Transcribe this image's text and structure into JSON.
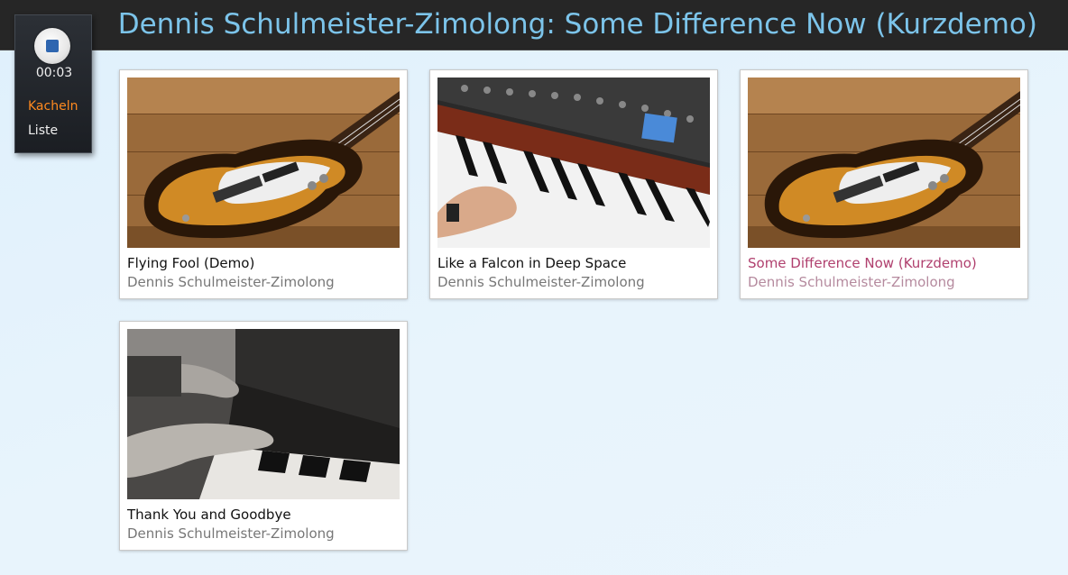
{
  "header": {
    "title": "Dennis Schulmeister-Zimolong: Some Difference Now (Kurzdemo)"
  },
  "player": {
    "time": "00:03",
    "stop_icon": "stop-icon",
    "views": {
      "tiles_label": "Kacheln",
      "list_label": "Liste",
      "active": "Kacheln"
    }
  },
  "colors": {
    "title": "#7cc4ea",
    "active_view": "#ff8a1f",
    "active_track": "#b0406e"
  },
  "tracks": [
    {
      "title": "Flying Fool (Demo)",
      "artist": "Dennis Schulmeister-Zimolong",
      "image": "bass-guitar-image",
      "active": false
    },
    {
      "title": "Like a Falcon in Deep Space",
      "artist": "Dennis Schulmeister-Zimolong",
      "image": "synthesizer-image",
      "active": false
    },
    {
      "title": "Some Difference Now (Kurzdemo)",
      "artist": "Dennis Schulmeister-Zimolong",
      "image": "bass-guitar-image",
      "active": true
    },
    {
      "title": "Thank You and Goodbye",
      "artist": "Dennis Schulmeister-Zimolong",
      "image": "piano-hands-image",
      "active": false
    }
  ]
}
